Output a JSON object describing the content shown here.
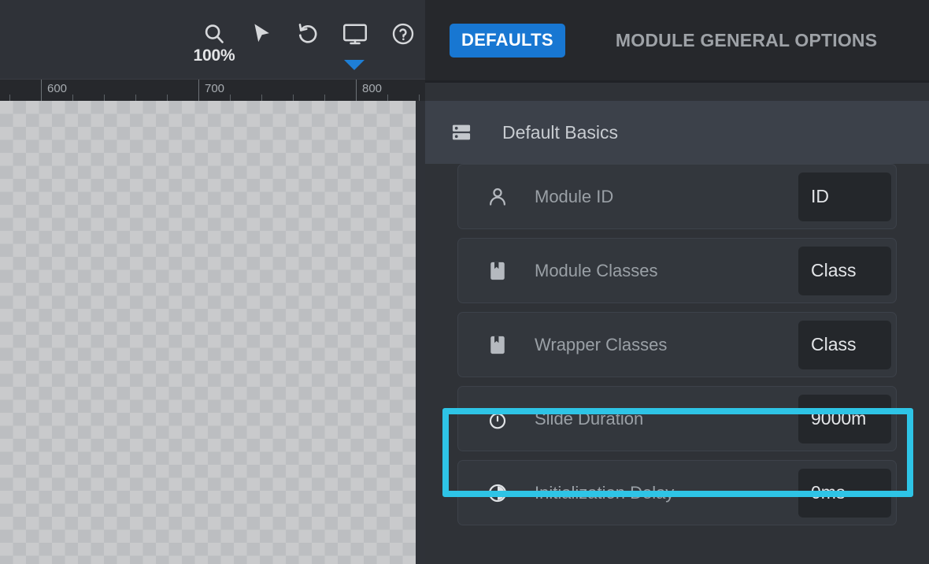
{
  "editor": {
    "toolbar": {
      "zoom_icon": "search-icon",
      "zoom_level": "100%",
      "cursor_icon": "cursor-arrow-icon",
      "undo_icon": "undo-icon",
      "screen_icon": "desktop-monitor-icon",
      "help_icon": "help-circle-icon",
      "active_indicator_color": "#1e7fd6"
    },
    "ruler": {
      "labels": [
        "600",
        "700",
        "800"
      ],
      "label_positions": [
        60,
        265,
        463
      ],
      "major_ticks": [
        52,
        252,
        452
      ],
      "minor_ticks": [
        12,
        92,
        132,
        172,
        212,
        292,
        332,
        372,
        412,
        492,
        532
      ]
    },
    "canvas": {
      "type": "transparent-checkerboard"
    }
  },
  "panel": {
    "header": {
      "defaults_label": "DEFAULTS",
      "defaults_color": "#1877d2",
      "title": "MODULE GENERAL OPTIONS"
    },
    "section": {
      "icon": "server-list-icon",
      "label": "Default Basics"
    },
    "rows": [
      {
        "icon": "person-icon",
        "label": "Module ID",
        "value": "ID",
        "highlighted": false
      },
      {
        "icon": "bookmark-icon",
        "label": "Module Classes",
        "value": "Class",
        "highlighted": false
      },
      {
        "icon": "bookmark-icon",
        "label": "Wrapper Classes",
        "value": "Class",
        "highlighted": false
      },
      {
        "icon": "stopwatch-icon",
        "label": "Slide Duration",
        "value": "9000m",
        "highlighted": true
      },
      {
        "icon": "clock-delay-icon",
        "label": "Initialization Delay",
        "value": "0ms",
        "highlighted": false
      }
    ]
  },
  "annotation": {
    "highlight_color": "#2ec4e6",
    "target": "Slide Duration"
  }
}
